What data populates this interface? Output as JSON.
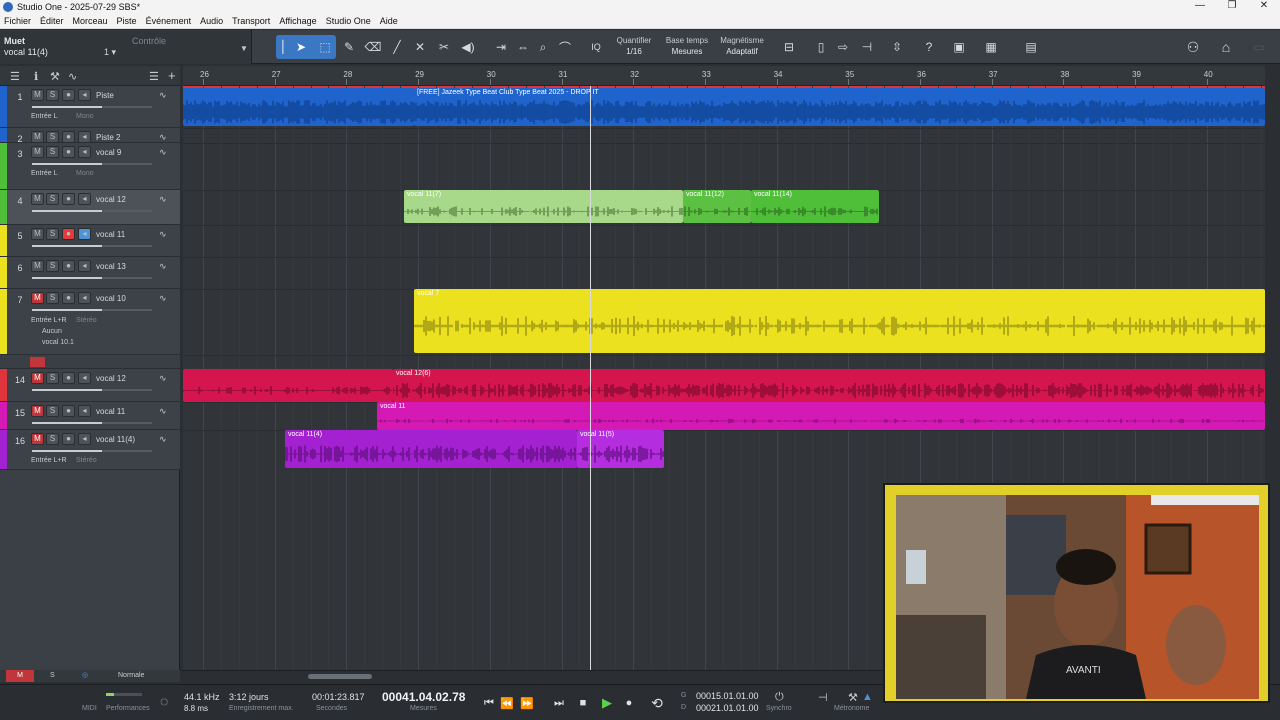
{
  "window": {
    "title": "Studio One - 2025-07-29 SBS*",
    "controls": [
      "—",
      "❐",
      "✕"
    ]
  },
  "menu": [
    "Fichier",
    "Éditer",
    "Morceau",
    "Piste",
    "Événement",
    "Audio",
    "Transport",
    "Affichage",
    "Studio One",
    "Aide"
  ],
  "selection": {
    "state": "Muet",
    "controle_label": "Contrôle",
    "item": "vocal 11(4)",
    "value": "1 ▾"
  },
  "toolbar": {
    "quantize_label": "Quantifier",
    "quantize_value": "1/16",
    "timebase_label": "Base temps",
    "timebase_value": "Mesures",
    "snap_label": "Magnétisme",
    "snap_value": "Adaptatif",
    "iq_label": "IQ",
    "help_label": "?"
  },
  "ruler": {
    "bars": [
      "26",
      "27",
      "28",
      "29",
      "30",
      "31",
      "32",
      "33",
      "34",
      "35",
      "36",
      "37",
      "38",
      "39",
      "40"
    ]
  },
  "colors": {
    "blue": "#1f63cc",
    "green": "#4fbf3a",
    "light_green": "#a8d98a",
    "yellow": "#ece11e",
    "crimson": "#d4154e",
    "magenta": "#d419b4",
    "purple": "#a321d0",
    "red": "#e0343d"
  },
  "tracks": [
    {
      "num": "1",
      "name": "Piste",
      "input": "Entrée L",
      "mode": "Mono"
    },
    {
      "num": "2",
      "name": "Piste 2"
    },
    {
      "num": "3",
      "name": "vocal 9",
      "input": "Entrée L",
      "mode": "Mono"
    },
    {
      "num": "4",
      "name": "vocal 12"
    },
    {
      "num": "5",
      "name": "vocal 11"
    },
    {
      "num": "6",
      "name": "vocal 13"
    },
    {
      "num": "7",
      "name": "vocal 10",
      "input": "Entrée L+R",
      "mode": "Stéréo",
      "send": "Aucun",
      "insert": "vocal 10.1"
    },
    {
      "num": "14",
      "name": "vocal 12"
    },
    {
      "num": "15",
      "name": "vocal 11"
    },
    {
      "num": "16",
      "name": "vocal 11(4)",
      "input": "Entrée L+R",
      "mode": "Stéréo"
    }
  ],
  "clips": {
    "beat": "[FREE] Jazeek Type Beat  Club Type Beat 2025 - DROP IT",
    "v11_7": "vocal 11(7)",
    "v11_12": "vocal 11(12)",
    "v11_14": "vocal 11(14)",
    "vocal7": "vocal 7",
    "v12_6": "vocal 12(6)",
    "v11": "vocal 11",
    "v11_4": "vocal 11(4)",
    "v11_5": "vocal 11(5)"
  },
  "bottom": {
    "m": "M",
    "s": "S",
    "mode": "Normale"
  },
  "transport": {
    "midi": "MIDI",
    "perf": "Performances",
    "rate": "44.1 kHz",
    "latency": "8.8 ms",
    "rec_days": "3:12 jours",
    "rec_label": "Enregistrement max.",
    "time": "00:01:23.817",
    "time_unit": "Secondes",
    "position": "00041.04.02.78",
    "position_unit": "Mesures",
    "loop_start_label": "G",
    "loop_start": "00015.01.01.00",
    "loop_end_label": "D",
    "loop_end": "00021.01.01.00",
    "sync_label": "Synchro",
    "metro_label": "Métronome"
  }
}
